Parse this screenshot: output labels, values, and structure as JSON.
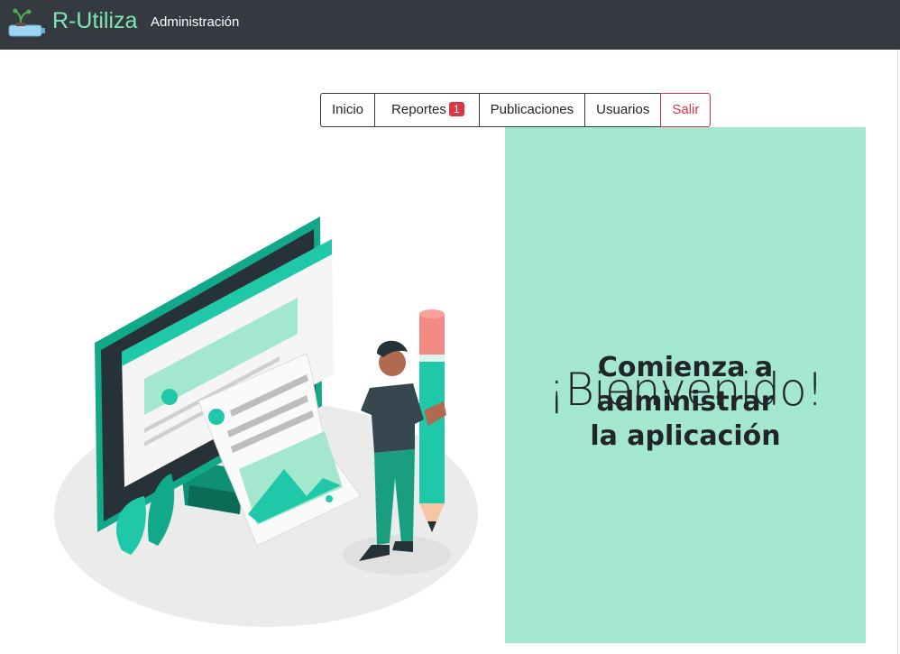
{
  "header": {
    "brand": "R-Utiliza",
    "section": "Administración"
  },
  "nav": {
    "items": [
      {
        "label": "Inicio"
      },
      {
        "label": "Reportes",
        "badge": "1"
      },
      {
        "label": "Publicaciones"
      },
      {
        "label": "Usuarios"
      },
      {
        "label": "Salir"
      }
    ]
  },
  "welcome": {
    "title": "¡Bienvenido!",
    "subtitle_line1": "Comienza a administrar",
    "subtitle_line2": "la aplicación"
  },
  "colors": {
    "navbar": "#343a40",
    "brand": "#7ee6b6",
    "panel": "#a3e7cf",
    "danger": "#dc3545",
    "illustration_accent": "#1fc8a8"
  }
}
